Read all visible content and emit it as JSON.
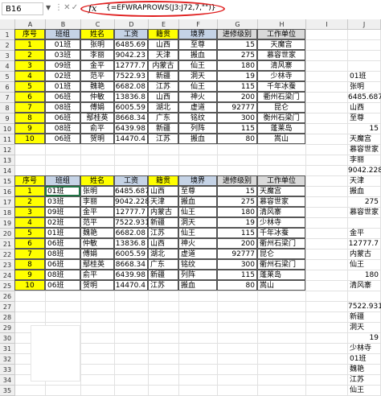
{
  "formula_bar": {
    "name_box": "B16",
    "fx": "fx",
    "formula": "{=EFWRAPROWS(J3:J72,7,\"\")}"
  },
  "columns": [
    "A",
    "B",
    "C",
    "D",
    "E",
    "F",
    "G",
    "H",
    "I",
    "J"
  ],
  "rows": [
    "1",
    "2",
    "3",
    "4",
    "5",
    "6",
    "7",
    "8",
    "9",
    "10",
    "11",
    "12",
    "13",
    "14",
    "15",
    "16",
    "17",
    "18",
    "19",
    "20",
    "21",
    "22",
    "23",
    "24",
    "25",
    "26",
    "27",
    "28",
    "29",
    "30",
    "31",
    "32",
    "33",
    "34",
    "35"
  ],
  "headers": [
    "序号",
    "班组",
    "姓名",
    "工资",
    "籍贯",
    "境界",
    "进修级别",
    "工作单位"
  ],
  "table1": [
    [
      "1",
      "01班",
      "张明",
      "6485.69",
      "山西",
      "至尊",
      "15",
      "天魔宫"
    ],
    [
      "2",
      "03班",
      "李丽",
      "9042.23",
      "天津",
      "搬血",
      "275",
      "慕容世家"
    ],
    [
      "3",
      "09班",
      "金平",
      "12777.7",
      "内蒙古",
      "仙王",
      "180",
      "清风寨"
    ],
    [
      "4",
      "02班",
      "范平",
      "7522.93",
      "新疆",
      "洞天",
      "19",
      "少林寺"
    ],
    [
      "5",
      "01班",
      "魏艳",
      "6682.08",
      "江苏",
      "仙王",
      "115",
      "千年冰蚕"
    ],
    [
      "6",
      "06班",
      "仲敏",
      "13836.8",
      "山西",
      "神火",
      "200",
      "衢州石梁门"
    ],
    [
      "7",
      "08班",
      "傅娟",
      "6005.59",
      "湖北",
      "虚道",
      "92777",
      "昆仑"
    ],
    [
      "8",
      "06班",
      "鄢桂英",
      "8668.34",
      "广东",
      "铭纹",
      "300",
      "衡州石梁门"
    ],
    [
      "9",
      "08班",
      "俞平",
      "6439.98",
      "新疆",
      "列阵",
      "115",
      "蓬莱岛"
    ],
    [
      "10",
      "06班",
      "贺明",
      "14470.4",
      "江苏",
      "搬血",
      "80",
      "嵩山"
    ]
  ],
  "table2": [
    [
      "1",
      "01班",
      "张明",
      "6485.687",
      "山西",
      "至尊",
      "15",
      "天魔宫"
    ],
    [
      "2",
      "03班",
      "李丽",
      "9042.228",
      "天津",
      "搬血",
      "275",
      "慕容世家"
    ],
    [
      "3",
      "09班",
      "金平",
      "12777.7",
      "内蒙古",
      "仙王",
      "180",
      "清风寨"
    ],
    [
      "4",
      "02班",
      "范平",
      "7522.931",
      "新疆",
      "洞天",
      "19",
      "少林寺"
    ],
    [
      "5",
      "01班",
      "魏艳",
      "6682.08",
      "江苏",
      "仙王",
      "115",
      "千年冰蚕"
    ],
    [
      "6",
      "06班",
      "仲敏",
      "13836.8",
      "山西",
      "神火",
      "200",
      "衢州石梁门"
    ],
    [
      "7",
      "08班",
      "傅娟",
      "6005.59",
      "湖北",
      "虚道",
      "92777",
      "昆仑"
    ],
    [
      "8",
      "06班",
      "鄢桂英",
      "8668.34",
      "广东",
      "铭纹",
      "300",
      "衢州石梁门"
    ],
    [
      "9",
      "08班",
      "俞平",
      "6439.98",
      "新疆",
      "列阵",
      "115",
      "蓬莱岛"
    ],
    [
      "10",
      "06班",
      "贺明",
      "14470.4",
      "江苏",
      "搬血",
      "80",
      "嵩山"
    ]
  ],
  "col_j": [
    {
      "row": 5,
      "v": "01班",
      "a": "l"
    },
    {
      "row": 6,
      "v": "张明",
      "a": "l"
    },
    {
      "row": 7,
      "v": "6485.687",
      "a": "r"
    },
    {
      "row": 8,
      "v": "山西",
      "a": "l"
    },
    {
      "row": 9,
      "v": "至尊",
      "a": "l"
    },
    {
      "row": 10,
      "v": "15",
      "a": "r"
    },
    {
      "row": 11,
      "v": "天魔宫",
      "a": "l"
    },
    {
      "row": 12,
      "v": "慕容世家",
      "a": "l"
    },
    {
      "row": 13,
      "v": "李丽",
      "a": "l"
    },
    {
      "row": 14,
      "v": "9042.228",
      "a": "r"
    },
    {
      "row": 15,
      "v": "天津",
      "a": "l"
    },
    {
      "row": 16,
      "v": "搬血",
      "a": "l"
    },
    {
      "row": 17,
      "v": "275",
      "a": "r"
    },
    {
      "row": 18,
      "v": "慕容世家",
      "a": "l"
    },
    {
      "row": 19,
      "v": "",
      "a": "l"
    },
    {
      "row": 20,
      "v": "金平",
      "a": "l"
    },
    {
      "row": 21,
      "v": "12777.7",
      "a": "r"
    },
    {
      "row": 22,
      "v": "内蒙古",
      "a": "l"
    },
    {
      "row": 23,
      "v": "仙王",
      "a": "l"
    },
    {
      "row": 24,
      "v": "180",
      "a": "r"
    },
    {
      "row": 25,
      "v": "清风寨",
      "a": "l"
    },
    {
      "row": 26,
      "v": "",
      "a": "l"
    },
    {
      "row": 27,
      "v": "7522.931",
      "a": "r"
    },
    {
      "row": 28,
      "v": "新疆",
      "a": "l"
    },
    {
      "row": 29,
      "v": "洞天",
      "a": "l"
    },
    {
      "row": 30,
      "v": "19",
      "a": "r"
    },
    {
      "row": 31,
      "v": "少林寺",
      "a": "l"
    },
    {
      "row": 32,
      "v": "01班",
      "a": "l"
    },
    {
      "row": 33,
      "v": "魏艳",
      "a": "l"
    },
    {
      "row": 34,
      "v": "江苏",
      "a": "l"
    },
    {
      "row": 35,
      "v": "仙王",
      "a": "l"
    }
  ]
}
